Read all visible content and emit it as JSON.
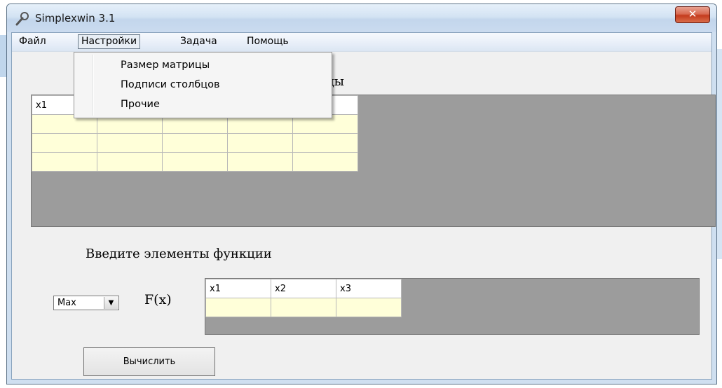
{
  "window": {
    "title": "Simplexwin 3.1",
    "close_glyph": "✕"
  },
  "menu": {
    "items": [
      {
        "label": "Файл"
      },
      {
        "label": "Настройки"
      },
      {
        "label": "Задача"
      },
      {
        "label": "Помощь"
      }
    ],
    "dropdown": [
      {
        "label": "Размер матрицы"
      },
      {
        "label": "Подписи столбцов"
      },
      {
        "label": "Прочие"
      }
    ]
  },
  "matrix_section": {
    "title_visible_fragment": "цы",
    "header": [
      "x1",
      "",
      "",
      "",
      ""
    ],
    "rows": 3,
    "cols": 5
  },
  "function_section": {
    "title": "Введите элементы функции",
    "mode_select": {
      "value": "Max"
    },
    "fx_label": "F(x)",
    "header": [
      "x1",
      "x2",
      "x3"
    ]
  },
  "actions": {
    "calculate_label": "Вычислить"
  },
  "colors": {
    "cell_fill": "#ffffd9",
    "grid_background": "#9c9c9c",
    "close_button": "#c43b1d"
  },
  "icons": {
    "app": "wrench-icon",
    "close": "close-icon",
    "dropdown_arrow": "chevron-down-icon"
  }
}
